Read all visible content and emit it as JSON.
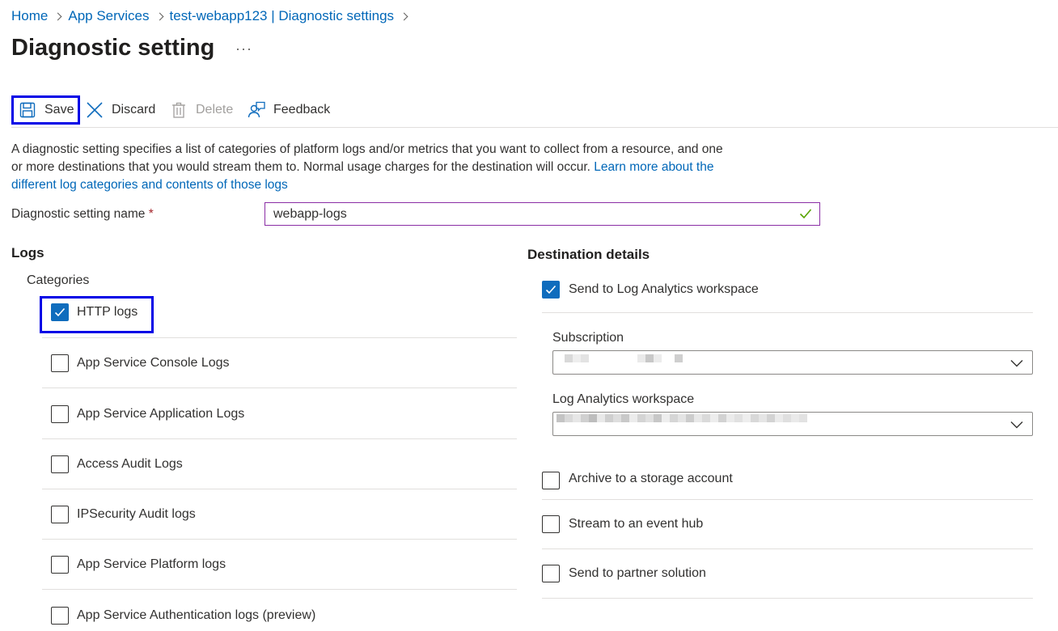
{
  "breadcrumb": [
    "Home",
    "App Services",
    "test-webapp123 | Diagnostic settings"
  ],
  "page_title": "Diagnostic setting",
  "more_label": "···",
  "toolbar": {
    "save": "Save",
    "discard": "Discard",
    "delete": "Delete",
    "feedback": "Feedback"
  },
  "description": {
    "text": "A diagnostic setting specifies a list of categories of platform logs and/or metrics that you want to collect from a resource, and one or more destinations that you would stream them to. Normal usage charges for the destination will occur. ",
    "link": "Learn more about the different log categories and contents of those logs"
  },
  "setting_name": {
    "label": "Diagnostic setting name",
    "required_mark": "*",
    "value": "webapp-logs"
  },
  "logs": {
    "heading": "Logs",
    "categories_label": "Categories",
    "items": [
      {
        "label": "HTTP logs",
        "checked": true
      },
      {
        "label": "App Service Console Logs",
        "checked": false
      },
      {
        "label": "App Service Application Logs",
        "checked": false
      },
      {
        "label": "Access Audit Logs",
        "checked": false
      },
      {
        "label": "IPSecurity Audit logs",
        "checked": false
      },
      {
        "label": "App Service Platform logs",
        "checked": false
      },
      {
        "label": "App Service Authentication logs (preview)",
        "checked": false
      }
    ]
  },
  "destination": {
    "heading": "Destination details",
    "log_analytics": {
      "label": "Send to Log Analytics workspace",
      "checked": true
    },
    "subscription_label": "Subscription",
    "workspace_label": "Log Analytics workspace",
    "archive": {
      "label": "Archive to a storage account",
      "checked": false
    },
    "event_hub": {
      "label": "Stream to an event hub",
      "checked": false
    },
    "partner": {
      "label": "Send to partner solution",
      "checked": false
    }
  },
  "colors": {
    "accent": "#0f6cbd",
    "link": "#0067b8",
    "highlight": "#0000e6",
    "valid_check": "#57a300"
  }
}
